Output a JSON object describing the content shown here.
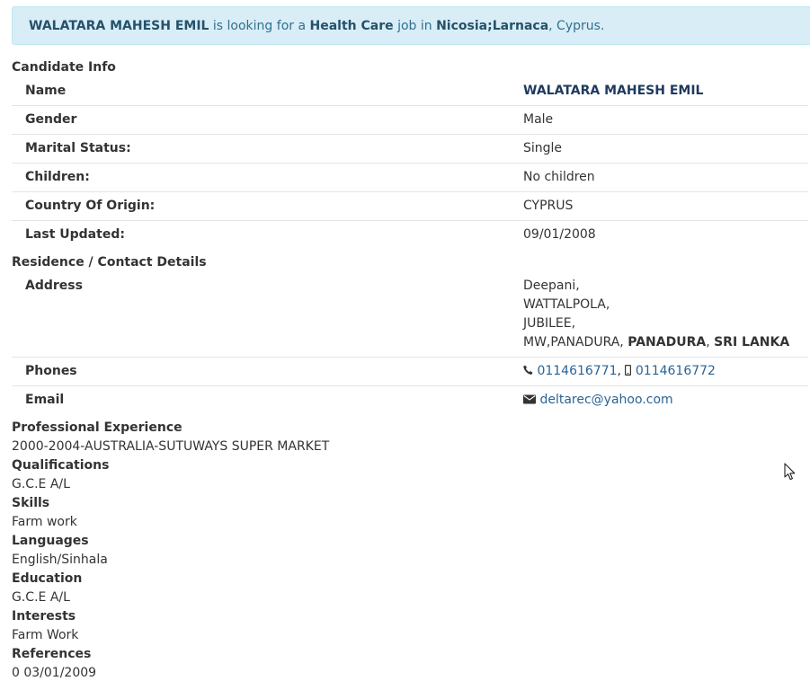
{
  "banner": {
    "name": "WALATARA MAHESH EMIL",
    "t1": " is looking for a ",
    "job": "Health Care",
    "t2": " job in ",
    "location": "Nicosia;Larnaca",
    "t3": ", Cyprus."
  },
  "candidate": {
    "heading": "Candidate Info",
    "rows": [
      {
        "label": "Name",
        "value": "WALATARA MAHESH EMIL"
      },
      {
        "label": "Gender",
        "value": "Male"
      },
      {
        "label": "Marital Status:",
        "value": "Single"
      },
      {
        "label": "Children:",
        "value": "No children"
      },
      {
        "label": "Country Of Origin:",
        "value": "CYPRUS"
      },
      {
        "label": "Last Updated:",
        "value": "09/01/2008"
      }
    ]
  },
  "residence": {
    "heading": "Residence / Contact Details",
    "address_label": "Address",
    "address_lines": [
      "Deepani,",
      "WATTALPOLA,",
      "JUBILEE,"
    ],
    "address_last_prefix": "MW,PANADURA, ",
    "address_city": "PANADURA",
    "address_sep": ", ",
    "address_country": "SRI LANKA",
    "phones_label": "Phones",
    "phone1": "0114616771",
    "phone_sep": ", ",
    "phone2": "0114616772",
    "email_label": "Email",
    "email": "deltarec@yahoo.com"
  },
  "details": [
    {
      "heading": "Professional Experience",
      "value": "2000-2004-AUSTRALIA-SUTUWAYS SUPER MARKET"
    },
    {
      "heading": "Qualifications",
      "value": "G.C.E A/L"
    },
    {
      "heading": "Skills",
      "value": "Farm work"
    },
    {
      "heading": "Languages",
      "value": "English/Sinhala"
    },
    {
      "heading": "Education",
      "value": "G.C.E A/L"
    },
    {
      "heading": "Interests",
      "value": "Farm Work"
    },
    {
      "heading": "References",
      "value": "0 03/01/2009"
    }
  ],
  "icons": {
    "phone": "phone-icon",
    "mobile": "mobile-icon",
    "email": "envelope-icon",
    "cursor": "mouse-pointer-icon"
  }
}
